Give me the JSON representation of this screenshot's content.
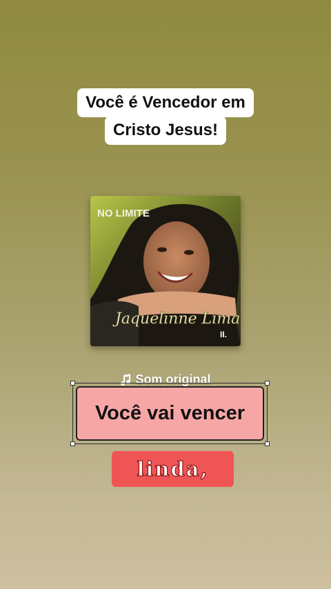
{
  "caption": {
    "line1": "Você é Vencedor em",
    "line2": "Cristo Jesus!"
  },
  "album": {
    "cover_title": "NO LIMITE",
    "artist_signature": "Jaquelinne Lima",
    "volume": "II."
  },
  "sound": {
    "icon": "music-note-icon",
    "label": "Som original"
  },
  "stickers": {
    "pink_text": "Você vai vencer",
    "red_text": "linda,"
  },
  "colors": {
    "pink_sticker": "#f7a6a6",
    "red_sticker": "#f05555",
    "caption_bg": "#ffffff"
  }
}
